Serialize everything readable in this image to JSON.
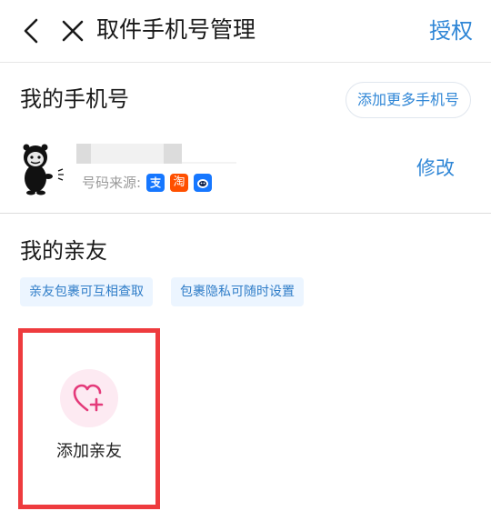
{
  "header": {
    "title": "取件手机号管理",
    "authorize_label": "授权"
  },
  "my_phone": {
    "section_title": "我的手机号",
    "add_more_label": "添加更多手机号",
    "source_label": "号码来源:",
    "sources": [
      {
        "name": "alipay-icon",
        "glyph": "支",
        "color": "#1677ff"
      },
      {
        "name": "taobao-icon",
        "glyph": "淘",
        "color": "#ff5000"
      },
      {
        "name": "cainiao-icon",
        "glyph": "",
        "color": "#1677ff"
      }
    ],
    "modify_label": "修改"
  },
  "relatives": {
    "section_title": "我的亲友",
    "tags": [
      "亲友包裹可互相查取",
      "包裹隐私可随时设置"
    ],
    "add_label": "添加亲友"
  },
  "colors": {
    "accent": "#2f86d6",
    "highlight": "#ee3b3e",
    "heart": "#e43a7a"
  }
}
